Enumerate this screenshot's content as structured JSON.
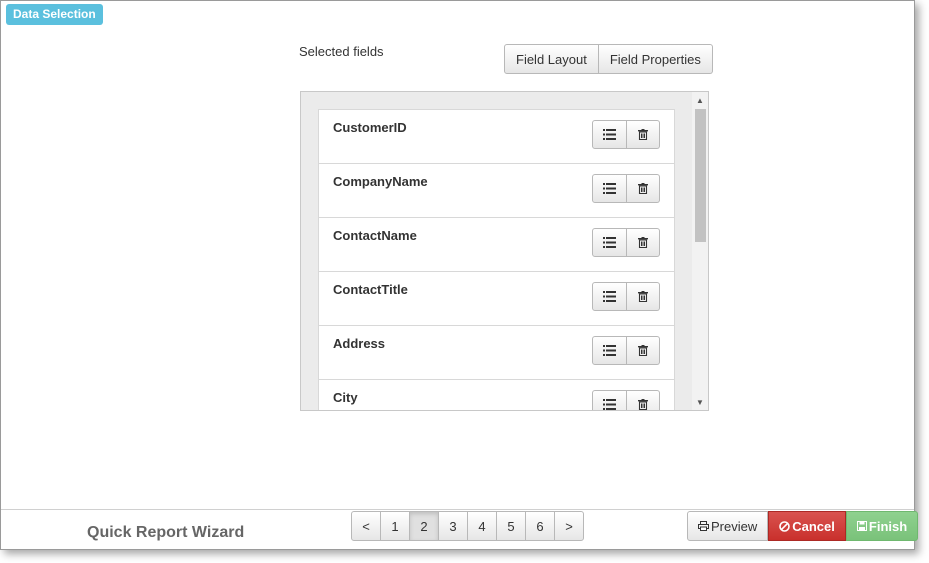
{
  "header": {
    "section_label": "Data Selection"
  },
  "fields_panel": {
    "label": "Selected fields",
    "tabs": [
      "Field Layout",
      "Field Properties"
    ],
    "items": [
      {
        "name": "CustomerID"
      },
      {
        "name": "CompanyName"
      },
      {
        "name": "ContactName"
      },
      {
        "name": "ContactTitle"
      },
      {
        "name": "Address"
      },
      {
        "name": "City"
      }
    ],
    "row_icons": [
      "list-icon",
      "trash-icon"
    ]
  },
  "footer": {
    "title": "Quick Report Wizard",
    "pager": {
      "prev": "<",
      "pages": [
        "1",
        "2",
        "3",
        "4",
        "5",
        "6"
      ],
      "next": ">",
      "current": "2"
    },
    "actions": {
      "preview": "Preview",
      "cancel": "Cancel",
      "finish": "Finish"
    }
  },
  "colors": {
    "badge": "#5bc0de",
    "cancel": "#d9534f",
    "finish": "#7ac27a"
  }
}
